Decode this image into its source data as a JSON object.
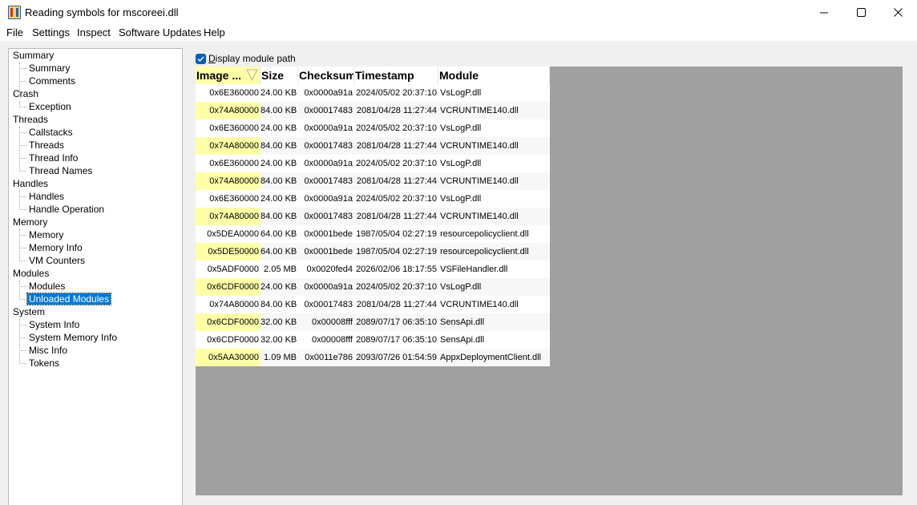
{
  "window": {
    "title": "Reading symbols for mscoreei.dll",
    "app_icon": "app-icon",
    "minimize_icon": "minimize-icon",
    "maximize_icon": "maximize-icon",
    "close_icon": "close-icon"
  },
  "menu": {
    "items": [
      "File",
      "Settings",
      "Inspect",
      "Software Updates",
      "Help"
    ]
  },
  "tree": {
    "groups": [
      {
        "label": "Summary",
        "children": [
          "Summary",
          "Comments"
        ]
      },
      {
        "label": "Crash",
        "children": [
          "Exception"
        ]
      },
      {
        "label": "Threads",
        "children": [
          "Callstacks",
          "Threads",
          "Thread Info",
          "Thread Names"
        ]
      },
      {
        "label": "Handles",
        "children": [
          "Handles",
          "Handle Operation"
        ]
      },
      {
        "label": "Memory",
        "children": [
          "Memory",
          "Memory Info",
          "VM Counters"
        ]
      },
      {
        "label": "Modules",
        "children": [
          "Modules",
          "Unloaded Modules"
        ]
      },
      {
        "label": "System",
        "children": [
          "System Info",
          "System Memory Info",
          "Misc Info",
          "Tokens"
        ]
      }
    ],
    "selected": "Unloaded Modules"
  },
  "options": {
    "display_module_path_label": "Display module path",
    "display_module_path_checked": true,
    "check_icon": "checkmark-icon"
  },
  "table": {
    "headers": [
      "Image ...",
      "Size",
      "Checksum",
      "Timestamp",
      "Module"
    ],
    "sort_icon": "sort-descending-icon",
    "rows": [
      [
        "0x6E360000",
        "24.00 KB",
        "0x0000a91a",
        "2024/05/02 20:37:10",
        "VsLogP.dll"
      ],
      [
        "0x74A80000",
        "84.00 KB",
        "0x00017483",
        "2081/04/28 11:27:44",
        "VCRUNTIME140.dll"
      ],
      [
        "0x6E360000",
        "24.00 KB",
        "0x0000a91a",
        "2024/05/02 20:37:10",
        "VsLogP.dll"
      ],
      [
        "0x74A80000",
        "84.00 KB",
        "0x00017483",
        "2081/04/28 11:27:44",
        "VCRUNTIME140.dll"
      ],
      [
        "0x6E360000",
        "24.00 KB",
        "0x0000a91a",
        "2024/05/02 20:37:10",
        "VsLogP.dll"
      ],
      [
        "0x74A80000",
        "84.00 KB",
        "0x00017483",
        "2081/04/28 11:27:44",
        "VCRUNTIME140.dll"
      ],
      [
        "0x6E360000",
        "24.00 KB",
        "0x0000a91a",
        "2024/05/02 20:37:10",
        "VsLogP.dll"
      ],
      [
        "0x74A80000",
        "84.00 KB",
        "0x00017483",
        "2081/04/28 11:27:44",
        "VCRUNTIME140.dll"
      ],
      [
        "0x5DEA0000",
        "64.00 KB",
        "0x0001bede",
        "1987/05/04 02:27:19",
        "resourcepolicyclient.dll"
      ],
      [
        "0x5DE50000",
        "64.00 KB",
        "0x0001bede",
        "1987/05/04 02:27:19",
        "resourcepolicyclient.dll"
      ],
      [
        "0x5ADF0000",
        "2.05 MB",
        "0x0020fed4",
        "2026/02/06 18:17:55",
        "VSFileHandler.dll"
      ],
      [
        "0x6CDF0000",
        "24.00 KB",
        "0x0000a91a",
        "2024/05/02 20:37:10",
        "VsLogP.dll"
      ],
      [
        "0x74A80000",
        "84.00 KB",
        "0x00017483",
        "2081/04/28 11:27:44",
        "VCRUNTIME140.dll"
      ],
      [
        "0x6CDF0000",
        "32.00 KB",
        "0x00008fff",
        "2089/07/17 06:35:10",
        "SensApi.dll"
      ],
      [
        "0x6CDF0000",
        "32.00 KB",
        "0x00008fff",
        "2089/07/17 06:35:10",
        "SensApi.dll"
      ],
      [
        "0x5AA30000",
        "1.09 MB",
        "0x0011e786",
        "2093/07/26 01:54:59",
        "AppxDeploymentClient.dll"
      ]
    ]
  }
}
